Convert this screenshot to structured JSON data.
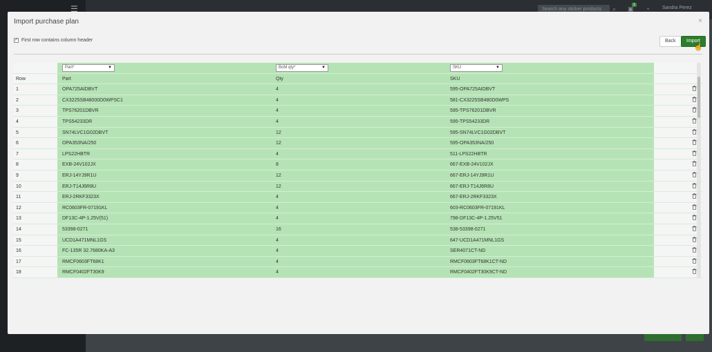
{
  "background": {
    "search_placeholder": "Search any sticker products",
    "user_name": "Sandra Perez",
    "notif_count": "1"
  },
  "modal": {
    "title": "Import purchase plan",
    "close_glyph": "×",
    "header_checkbox_label": "First row contains column header",
    "back_label": "Back",
    "import_label": "Import"
  },
  "mapping": {
    "part": "Part*",
    "qty": "BoM qty*",
    "sku": "SKU"
  },
  "table": {
    "headers": {
      "row": "Row",
      "part": "Part",
      "qty": "Qty",
      "sku": "SKU"
    },
    "rows": [
      {
        "n": "1",
        "part": "OPA725AIDBVT",
        "qty": "4",
        "sku": "595-OPA725AIDBVT"
      },
      {
        "n": "2",
        "part": "CX3225SB48000D0WPSC1",
        "qty": "4",
        "sku": "581-CX3225SB480D0WPS"
      },
      {
        "n": "3",
        "part": "TPS76201DBVR",
        "qty": "4",
        "sku": "595-TPS76201DBVR"
      },
      {
        "n": "4",
        "part": "TPS54233DR",
        "qty": "4",
        "sku": "595-TPS54233DR"
      },
      {
        "n": "5",
        "part": "SN74LVC1G02DBVT",
        "qty": "12",
        "sku": "595-SN74LVC1G02DBVT"
      },
      {
        "n": "6",
        "part": "OPA353NA/250",
        "qty": "12",
        "sku": "595-OPA353NA/250"
      },
      {
        "n": "7",
        "part": "LPS22HBTR",
        "qty": "4",
        "sku": "511-LPS22HBTR"
      },
      {
        "n": "8",
        "part": "EXB-24V102JX",
        "qty": "8",
        "sku": "667-EXB-24V102JX"
      },
      {
        "n": "9",
        "part": "ERJ-14YJ9R1U",
        "qty": "12",
        "sku": "667-ERJ-14YJ9R1U"
      },
      {
        "n": "10",
        "part": "ERJ-T14J6R8U",
        "qty": "12",
        "sku": "667-ERJ-T14J6R8U"
      },
      {
        "n": "11",
        "part": "ERJ-2RKF3323X",
        "qty": "4",
        "sku": "667-ERJ-2RKF3323X"
      },
      {
        "n": "12",
        "part": "RC0603FR-07191KL",
        "qty": "4",
        "sku": "603-RC0603FR-07191KL"
      },
      {
        "n": "13",
        "part": "DF13C-4P-1.25V(51)",
        "qty": "4",
        "sku": "798-DF13C-4P-1.25V51"
      },
      {
        "n": "14",
        "part": "53398-0271",
        "qty": "16",
        "sku": "538-53398-0271"
      },
      {
        "n": "15",
        "part": "UCD1A471MNL1GS",
        "qty": "4",
        "sku": "647-UCD1A471MNL1GS"
      },
      {
        "n": "16",
        "part": "FC-135R 32.7680KA-A3",
        "qty": "4",
        "sku": "SER4071CT-ND"
      },
      {
        "n": "17",
        "part": "RMCF0603FT68K1",
        "qty": "4",
        "sku": "RMCF0603FT68K1CT-ND"
      },
      {
        "n": "18",
        "part": "RMCF0402FT30K9",
        "qty": "4",
        "sku": "RMCF0402FT30K9CT-ND"
      }
    ]
  },
  "icons": {
    "trash": "trash-icon",
    "caret": "▼"
  },
  "colors": {
    "mapped_column_bg": "#b5e3b5",
    "import_button": "#2e7d2e"
  }
}
